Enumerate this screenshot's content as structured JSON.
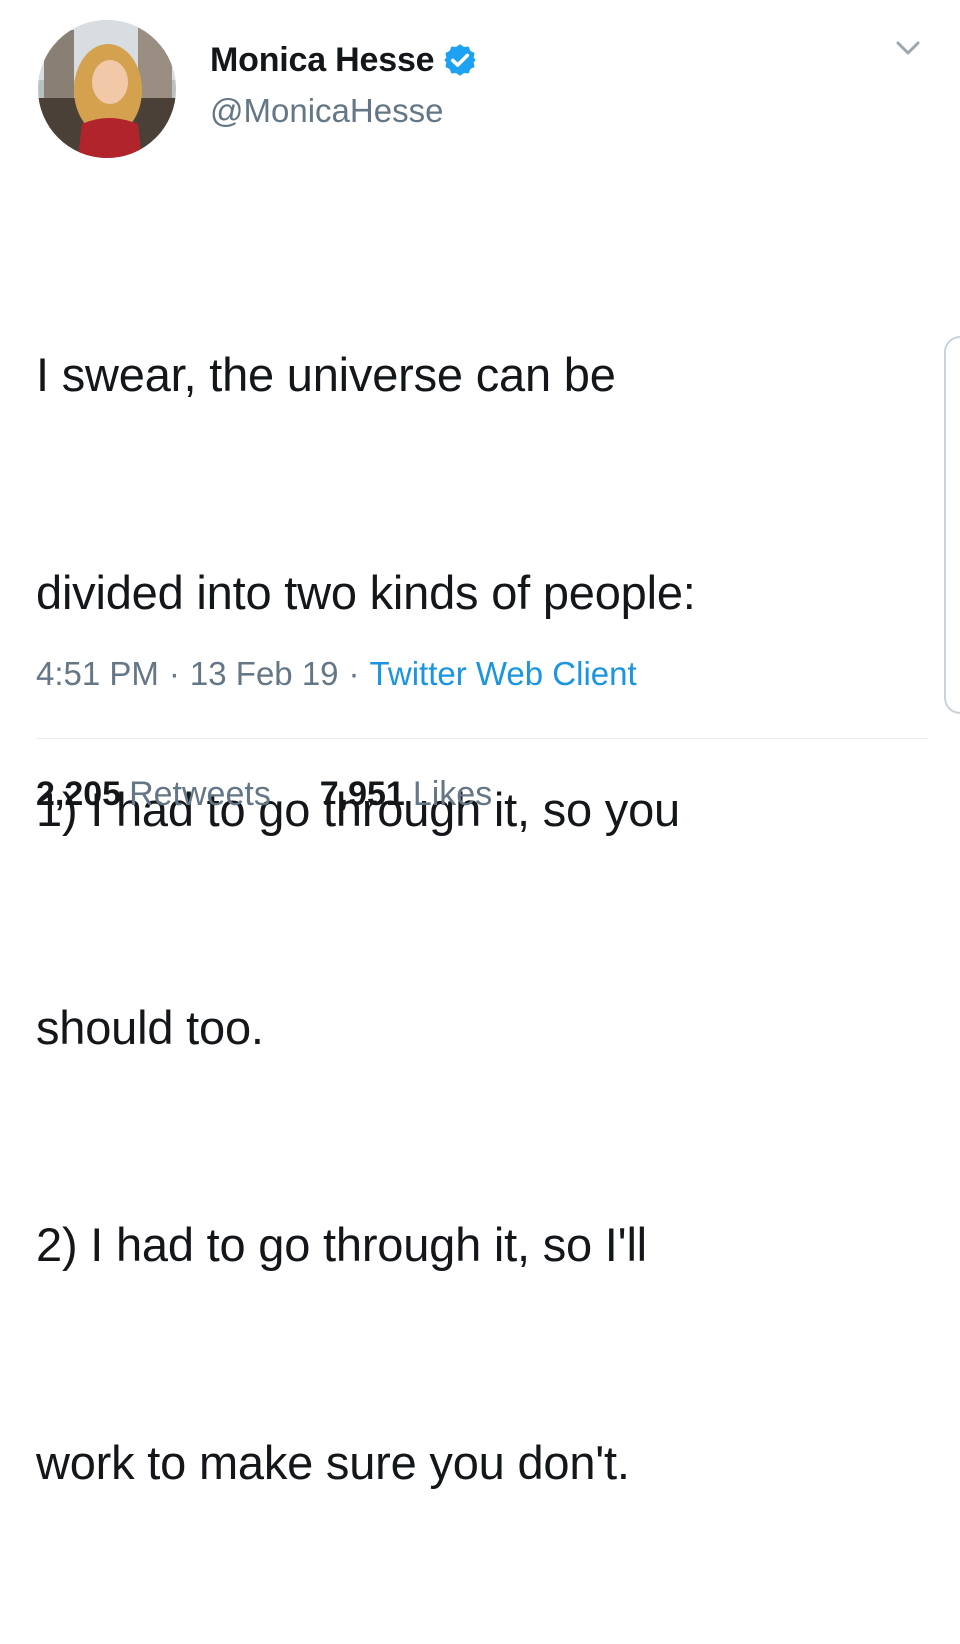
{
  "author": {
    "display_name": "Monica Hesse",
    "handle": "@MonicaHesse",
    "avatar_icon": "profile-photo-avatar",
    "verified_icon": "verified-badge-icon",
    "verified_color": "#1da1f2"
  },
  "tweet": {
    "text_lines": [
      "I swear, the universe can be",
      "divided into two kinds of people:",
      "1) I had to go through it, so you",
      "should too.",
      "2) I had to go through it, so I'll",
      "work to make sure you don't."
    ]
  },
  "meta": {
    "time": "4:51 PM",
    "separator": "·",
    "date": "13 Feb 19",
    "source": "Twitter Web Client"
  },
  "stats": {
    "retweets_count": "2,205",
    "retweets_label": "Retweets",
    "likes_count": "7,951",
    "likes_label": "Likes"
  },
  "icons": {
    "menu": "chevron-down-icon"
  },
  "colors": {
    "text": "#14171a",
    "secondary": "#657786",
    "link": "#1b95e0",
    "divider": "#e6ecf0"
  }
}
